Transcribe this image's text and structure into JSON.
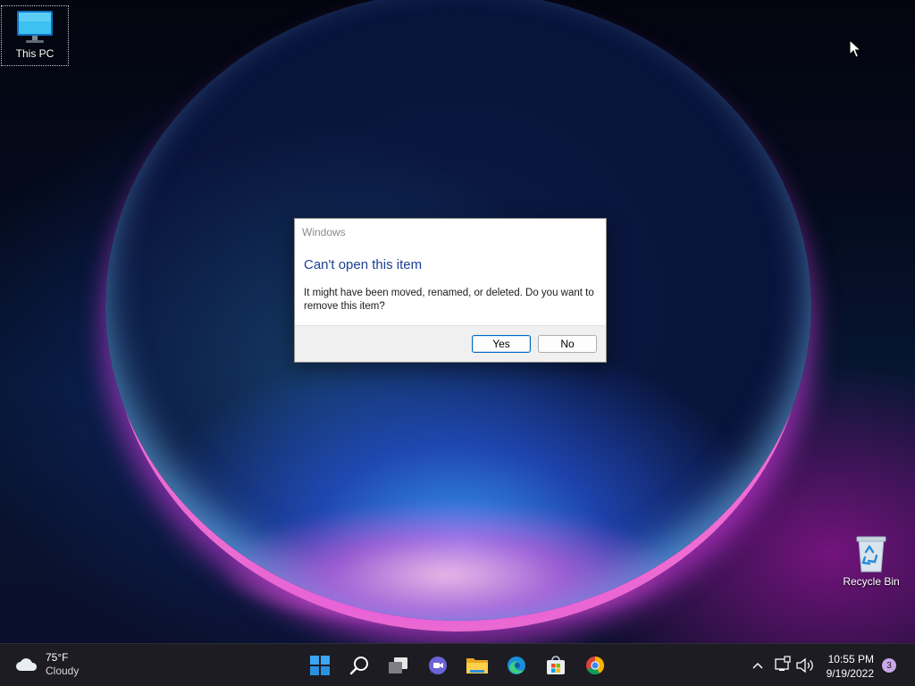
{
  "desktop": {
    "icons": [
      {
        "label": "This PC"
      },
      {
        "label": "Recycle Bin"
      }
    ]
  },
  "dialog": {
    "caption": "Windows",
    "heading": "Can't open this item",
    "message": "It might have been moved, renamed, or deleted. Do you want to remove this item?",
    "yes_label": "Yes",
    "no_label": "No"
  },
  "taskbar": {
    "weather": {
      "temp": "75°F",
      "condition": "Cloudy",
      "icon": "cloud-icon"
    },
    "apps": [
      {
        "icon": "windows-start-icon"
      },
      {
        "icon": "search-icon"
      },
      {
        "icon": "task-view-icon"
      },
      {
        "icon": "teams-chat-icon"
      },
      {
        "icon": "file-explorer-icon"
      },
      {
        "icon": "edge-icon"
      },
      {
        "icon": "store-icon"
      },
      {
        "icon": "chrome-icon"
      }
    ],
    "tray": {
      "time": "10:55 PM",
      "date": "9/19/2022",
      "notifications": "3"
    }
  },
  "colors": {
    "taskbar_bg": "#1c1c22",
    "dialog_heading": "#1c3f94",
    "accent": "#0067c0"
  }
}
